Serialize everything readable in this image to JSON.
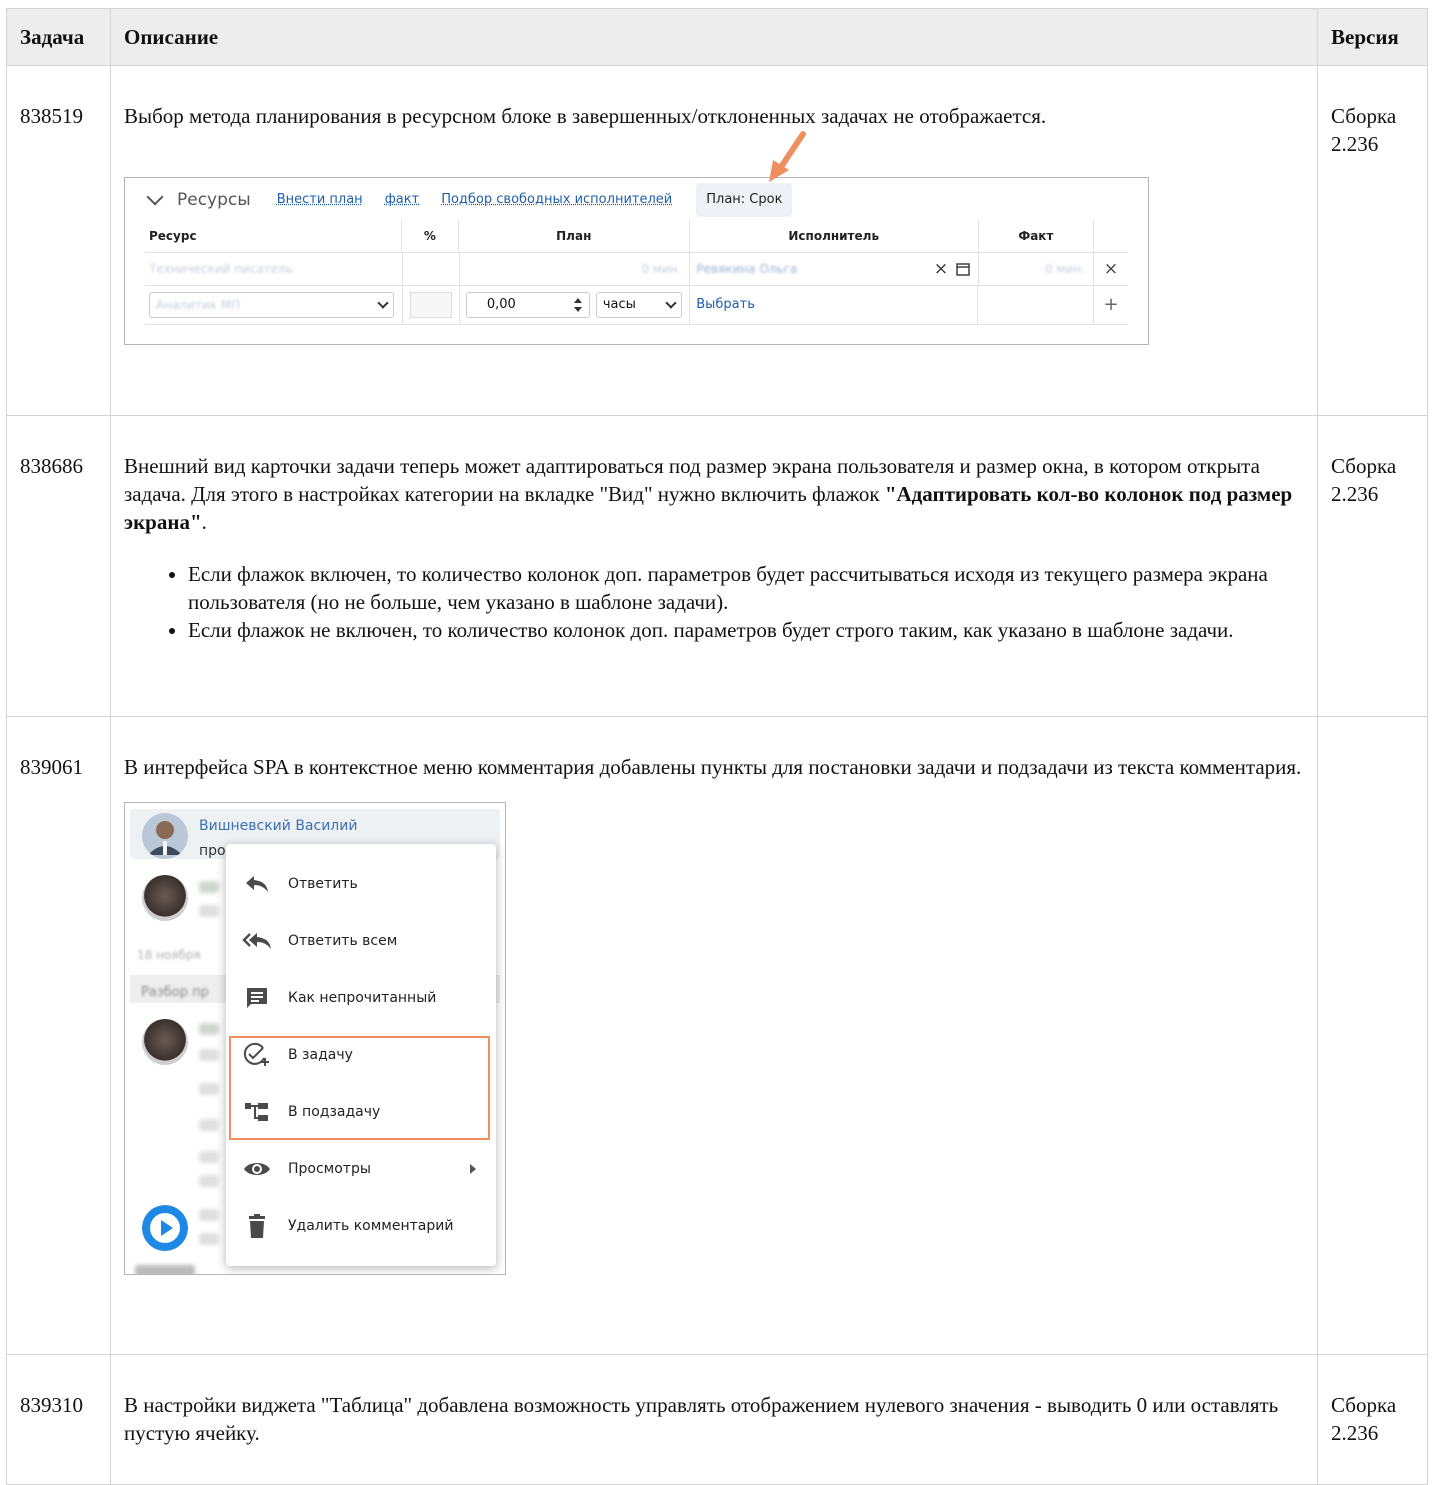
{
  "table": {
    "headers": {
      "task": "Задача",
      "description": "Описание",
      "version": "Версия"
    },
    "rows": [
      {
        "id": "838519",
        "text": "Выбор метода планирования в ресурсном блоке в завершенных/отклоненных задачах не отображается.",
        "version": "Сборка 2.236"
      },
      {
        "id": "838686",
        "text_before": "Внешний вид карточки задачи теперь может адаптироваться под размер экрана пользователя и размер окна, в котором открыта задача. Для этого в настройках категории на вкладке \"Вид\" нужно включить флажок ",
        "text_bold": "\"Адаптировать кол-во колонок под размер экрана\"",
        "text_after": ".",
        "bullets": [
          "Если флажок включен, то количество колонок доп. параметров будет рассчитываться исходя из текущего размера экрана пользователя (но не больше, чем указано в шаблоне задачи).",
          "Если флажок не включен, то количество колонок доп. параметров будет строго таким, как указано в шаблоне задачи."
        ],
        "version": "Сборка 2.236"
      },
      {
        "id": "839061",
        "text": "В интерфейса SPA в контекстное меню комментария добавлены пункты для постановки задачи и подзадачи из текста комментария.",
        "version": ""
      },
      {
        "id": "839310",
        "text": "В настройки виджета \"Таблица\" добавлена возможность управлять отображением нулевого значения - выводить 0 или оставлять пустую ячейку.",
        "version": "Сборка 2.236"
      }
    ]
  },
  "resources_screenshot": {
    "title": "Ресурсы",
    "links": [
      "Внести план",
      "факт",
      "Подбор свободных исполнителей"
    ],
    "plan_badge": "План: Срок",
    "columns": [
      "Ресурс",
      "%",
      "План",
      "Исполнитель",
      "Факт"
    ],
    "row1": {
      "resource": "Технический писатель",
      "plan": "0 мин.",
      "executor": "Ревякина Ольга",
      "fact": "0 мин.",
      "clear": "×",
      "remove": "×"
    },
    "row2": {
      "resource": "Аналитик МП",
      "amount": "0,00",
      "unit": "часы",
      "choose": "Выбрать",
      "add": "+"
    },
    "accent_color": "#ef8f5f"
  },
  "comment_menu_screenshot": {
    "author": "Вишневский Василий",
    "message_start": "прошу проверить",
    "date_fragment": "18 ноября",
    "side_label": "Разбор пр",
    "items": [
      {
        "label": "Ответить",
        "icon": "reply-icon"
      },
      {
        "label": "Ответить всем",
        "icon": "reply-all-icon"
      },
      {
        "label": "Как непрочитанный",
        "icon": "comment-icon"
      },
      {
        "label": "В задачу",
        "icon": "task-add-icon"
      },
      {
        "label": "В подзадачу",
        "icon": "subtask-icon"
      },
      {
        "label": "Просмотры",
        "icon": "eye-icon"
      },
      {
        "label": "Удалить комментарий",
        "icon": "trash-icon"
      }
    ],
    "highlight_color": "#ef8f5f"
  }
}
